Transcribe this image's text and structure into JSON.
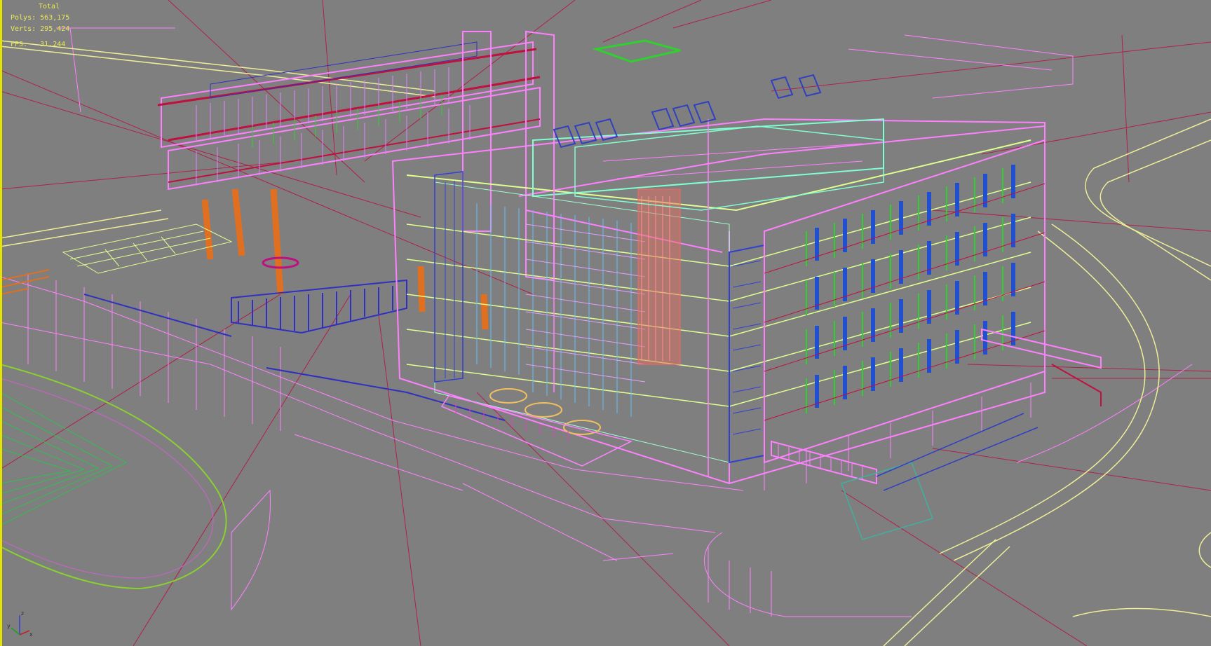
{
  "stats": {
    "header": "Total",
    "polys_label": "Polys:",
    "polys_value": "563,175",
    "verts_label": "Verts:",
    "verts_value": "295,424",
    "fps_label": "FPS:",
    "fps_value": "31.244"
  },
  "axis": {
    "x": "x",
    "y": "y",
    "z": "z"
  },
  "colors": {
    "viewport_bg": "#7f7f7f",
    "stats_text": "#e8e85a",
    "active_border": "#e4e400",
    "wire_pink": "#ff80ff",
    "wire_magenta": "#e040c0",
    "wire_red": "#c01040",
    "wire_blue": "#3030c0",
    "wire_green": "#30d030",
    "wire_cyan": "#80ffd0",
    "wire_yellow": "#f0f0a0",
    "wire_orange": "#e07020"
  }
}
